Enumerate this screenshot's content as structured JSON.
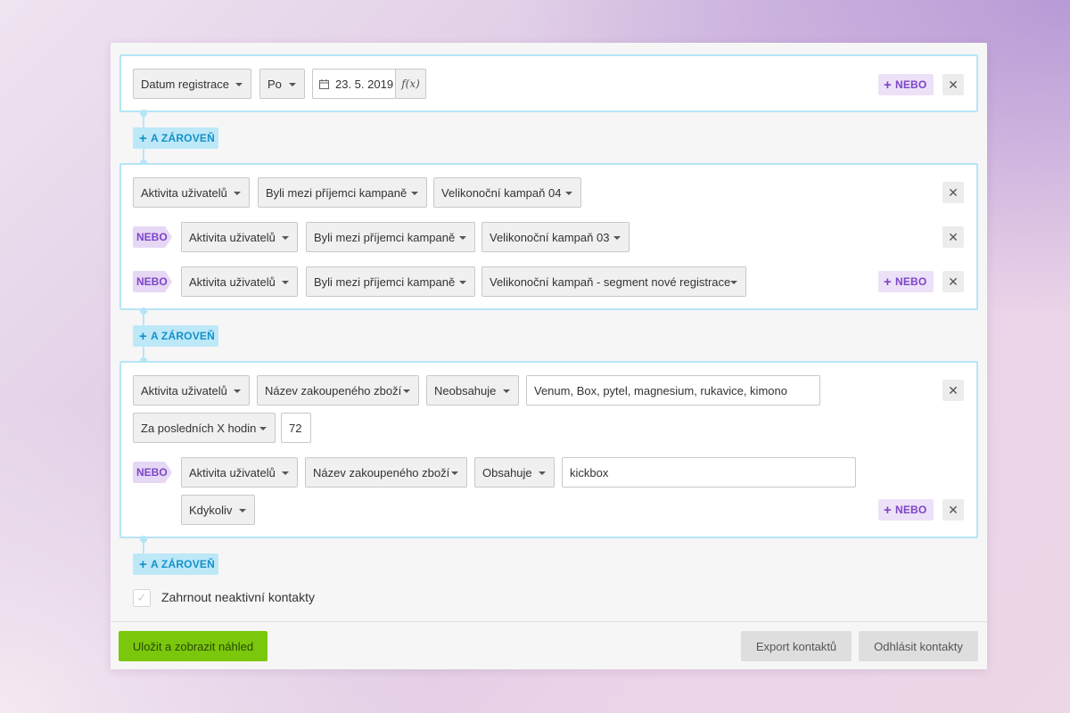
{
  "blocks": [
    {
      "rows": [
        {
          "field": "Datum registrace",
          "operator": "Po",
          "date": "23. 5. 2019",
          "fx_label": "f(x)"
        }
      ]
    },
    {
      "rows": [
        {
          "field": "Aktivita uživatelů",
          "condition": "Byli mezi příjemci kampaně",
          "value": "Velikonoční kampaň 04"
        },
        {
          "prefix": "NEBO",
          "field": "Aktivita uživatelů",
          "condition": "Byli mezi příjemci kampaně",
          "value": "Velikonoční kampaň 03"
        },
        {
          "prefix": "NEBO",
          "field": "Aktivita uživatelů",
          "condition": "Byli mezi příjemci kampaně",
          "value": "Velikonoční kampaň - segment nové registrace"
        }
      ]
    },
    {
      "rows": [
        {
          "field": "Aktivita uživatelů",
          "condition": "Název zakoupeného zboží",
          "operator": "Neobsahuje",
          "text": "Venum, Box, pytel, magnesium, rukavice, kimono",
          "time": "Za posledních X hodin",
          "hours": "72"
        },
        {
          "prefix": "NEBO",
          "field": "Aktivita uživatelů",
          "condition": "Název zakoupeného zboží",
          "operator": "Obsahuje",
          "text": "kickbox",
          "time": "Kdykoliv"
        }
      ]
    }
  ],
  "labels": {
    "or_button": "NEBO",
    "and_button": "A ZÁROVEŇ",
    "remove": "✕",
    "plus": "+"
  },
  "include_inactive": {
    "label": "Zahrnout neaktivní kontakty",
    "checked": false
  },
  "footer": {
    "save": "Uložit a zobrazit náhled",
    "export": "Export kontaktů",
    "unsubscribe": "Odhlásit kontakty"
  },
  "colors": {
    "accent_blue": "#1590c9",
    "accent_purple": "#7b44c9",
    "save_green": "#7ac70c",
    "block_border": "#b6e5f6"
  },
  "icons": [
    "calendar-icon",
    "function-icon",
    "close-icon",
    "plus-icon",
    "caret-down-icon",
    "check-icon"
  ]
}
